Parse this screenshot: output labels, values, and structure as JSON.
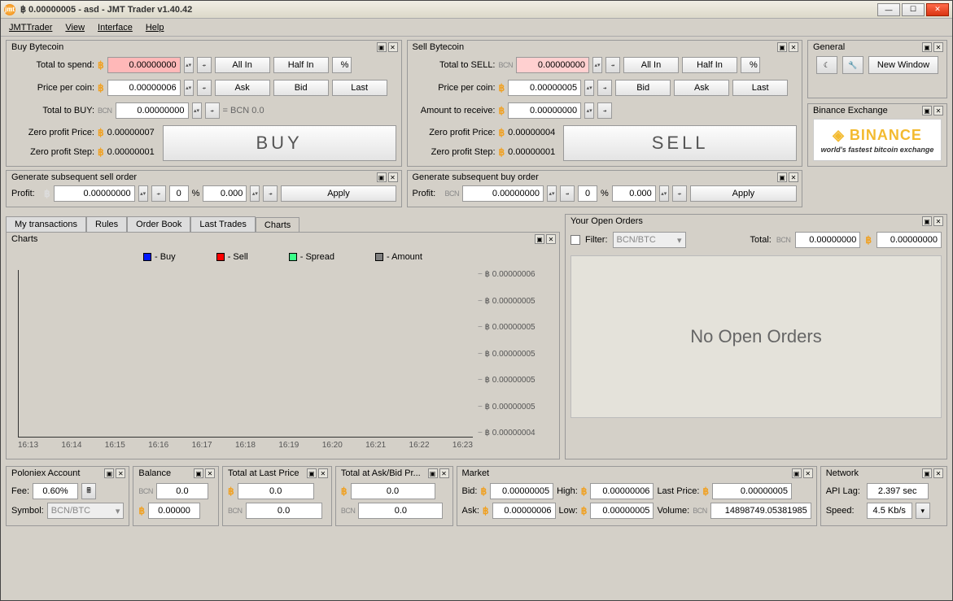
{
  "title": "฿ 0.00000005 - asd - JMT Trader v1.40.42",
  "menu": {
    "jmt": "JMTTrader",
    "view": "View",
    "interface": "Interface",
    "help": "Help"
  },
  "buy": {
    "head": "Buy Bytecoin",
    "total_spend_lbl": "Total to spend:",
    "total_spend": "0.00000000",
    "price_lbl": "Price per coin:",
    "price": "0.00000006",
    "total_buy_lbl": "Total to BUY:",
    "total_buy": "0.00000000",
    "eq": "= BCN 0.0",
    "zpp_lbl": "Zero profit Price:",
    "zpp": "0.00000007",
    "zps_lbl": "Zero profit Step:",
    "zps": "0.00000001",
    "allin": "All In",
    "halfin": "Half In",
    "pct": "%",
    "ask": "Ask",
    "bid": "Bid",
    "last": "Last",
    "big": "BUY"
  },
  "sell": {
    "head": "Sell Bytecoin",
    "total_sell_lbl": "Total to SELL:",
    "total_sell": "0.00000000",
    "price_lbl": "Price per coin:",
    "price": "0.00000005",
    "recv_lbl": "Amount to receive:",
    "recv": "0.00000000",
    "zpp_lbl": "Zero profit Price:",
    "zpp": "0.00000004",
    "zps_lbl": "Zero profit Step:",
    "zps": "0.00000001",
    "allin": "All In",
    "halfin": "Half In",
    "pct": "%",
    "bid": "Bid",
    "ask": "Ask",
    "last": "Last",
    "big": "SELL"
  },
  "general": {
    "head": "General",
    "newwin": "New Window"
  },
  "exch": {
    "head": "Binance Exchange",
    "name": "BINANCE",
    "tag": "world's fastest bitcoin exchange"
  },
  "gso": {
    "head": "Generate subsequent sell order",
    "profit_lbl": "Profit:",
    "val": "0.00000000",
    "zero": "0",
    "pct": "%",
    "pval": "0.000",
    "apply": "Apply"
  },
  "gbo": {
    "head": "Generate subsequent buy order",
    "profit_lbl": "Profit:",
    "val": "0.00000000",
    "zero": "0",
    "pct": "%",
    "pval": "0.000",
    "apply": "Apply"
  },
  "tabs": {
    "my": "My transactions",
    "rules": "Rules",
    "ob": "Order Book",
    "lt": "Last Trades",
    "charts": "Charts"
  },
  "chart": {
    "head": "Charts",
    "lg_buy": "- Buy",
    "lg_sell": "- Sell",
    "lg_spread": "- Spread",
    "lg_amt": "- Amount"
  },
  "chart_data": {
    "type": "line",
    "title": "Charts",
    "x_ticks": [
      "16:13",
      "16:14",
      "16:15",
      "16:16",
      "16:17",
      "16:18",
      "16:19",
      "16:20",
      "16:21",
      "16:22",
      "16:23"
    ],
    "y_ticks": [
      "฿ 0.00000006",
      "฿ 0.00000005",
      "฿ 0.00000005",
      "฿ 0.00000005",
      "฿ 0.00000005",
      "฿ 0.00000005",
      "฿ 0.00000004"
    ],
    "ylim": [
      4e-08,
      6e-08
    ],
    "series": [
      {
        "name": "Buy",
        "color": "#0018ff",
        "values": []
      },
      {
        "name": "Sell",
        "color": "#ff0000",
        "values": []
      },
      {
        "name": "Spread",
        "color": "#39ff88",
        "values": []
      },
      {
        "name": "Amount",
        "color": "#808080",
        "values": []
      }
    ]
  },
  "oo": {
    "head": "Your Open Orders",
    "filter": "Filter:",
    "pair": "BCN/BTC",
    "total_lbl": "Total:",
    "bcn_val": "0.00000000",
    "btc_val": "0.00000000",
    "empty": "No Open Orders"
  },
  "px": {
    "head": "Poloniex Account",
    "fee_lbl": "Fee:",
    "fee": "0.60%",
    "sym_lbl": "Symbol:",
    "sym": "BCN/BTC"
  },
  "bal": {
    "head": "Balance",
    "bcn": "0.0",
    "btc": "0.00000"
  },
  "tlp": {
    "head": "Total at Last Price",
    "v1": "0.0",
    "v2": "0.0"
  },
  "tab": {
    "head": "Total at Ask/Bid Pr...",
    "v1": "0.0",
    "v2": "0.0"
  },
  "mkt": {
    "head": "Market",
    "bid_lbl": "Bid:",
    "bid": "0.00000005",
    "high_lbl": "High:",
    "high": "0.00000006",
    "lp_lbl": "Last Price:",
    "lp": "0.00000005",
    "ask_lbl": "Ask:",
    "ask": "0.00000006",
    "low_lbl": "Low:",
    "low": "0.00000005",
    "vol_lbl": "Volume:",
    "vol": "14898749.05381985"
  },
  "net": {
    "head": "Network",
    "lag_lbl": "API Lag:",
    "lag": "2.397 sec",
    "spd_lbl": "Speed:",
    "spd": "4.5 Kb/s"
  },
  "bcn_tag": "BCN"
}
